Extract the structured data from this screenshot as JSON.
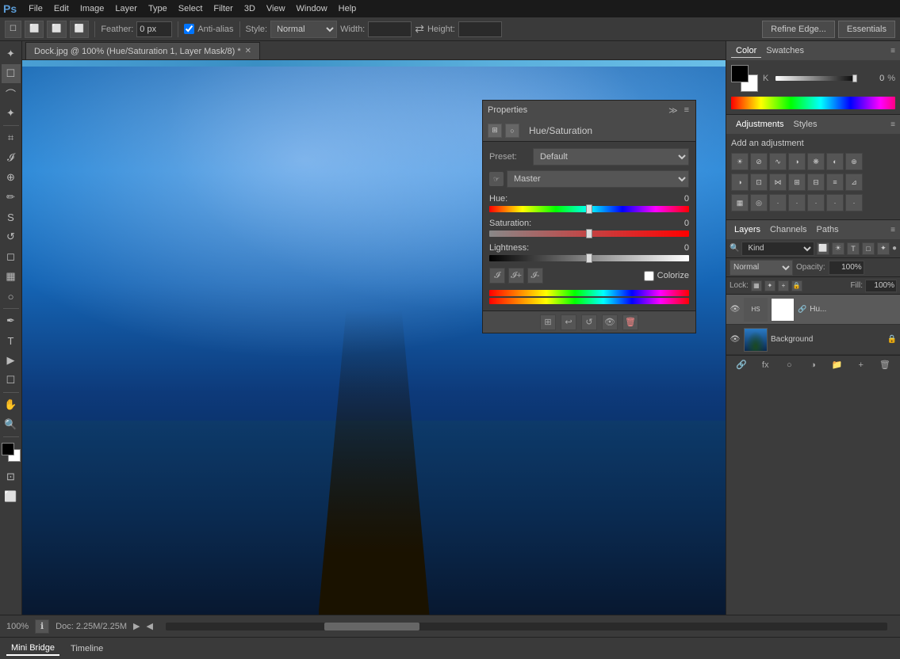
{
  "app": {
    "title": "Adobe Photoshop",
    "logo": "Ps",
    "workspace": "Essentials"
  },
  "menubar": {
    "items": [
      "PS",
      "File",
      "Edit",
      "Image",
      "Layer",
      "Type",
      "Select",
      "Filter",
      "3D",
      "View",
      "Window",
      "Help"
    ]
  },
  "toolbar": {
    "feather_label": "Feather:",
    "feather_value": "0 px",
    "anti_alias_label": "Anti-alias",
    "style_label": "Style:",
    "style_value": "Normal",
    "width_label": "Width:",
    "height_label": "Height:",
    "refine_edge_label": "Refine Edge...",
    "essentials_label": "Essentials"
  },
  "document": {
    "tab_title": "Dock.jpg @ 100% (Hue/Saturation 1, Layer Mask/8) *"
  },
  "properties_panel": {
    "title": "Properties",
    "adjustment_title": "Hue/Saturation",
    "preset_label": "Preset:",
    "preset_value": "Default",
    "channel_label": "Master",
    "hue_label": "Hue:",
    "hue_value": "0",
    "saturation_label": "Saturation:",
    "saturation_value": "0",
    "lightness_label": "Lightness:",
    "lightness_value": "0",
    "colorize_label": "Colorize"
  },
  "color_panel": {
    "tab_color": "Color",
    "tab_swatches": "Swatches",
    "k_label": "K",
    "k_value": "0",
    "k_percent": "%"
  },
  "adjustments_panel": {
    "tab_adjustments": "Adjustments",
    "tab_styles": "Styles",
    "title": "Add an adjustment"
  },
  "layers_panel": {
    "tab_layers": "Layers",
    "tab_channels": "Channels",
    "tab_paths": "Paths",
    "search_placeholder": "Kind",
    "blend_mode": "Normal",
    "opacity_label": "Opacity:",
    "opacity_value": "100%",
    "lock_label": "Lock:",
    "fill_label": "Fill:",
    "fill_value": "100%",
    "layers": [
      {
        "name": "Hu...",
        "type": "adjustment",
        "visible": true
      },
      {
        "name": "Background",
        "type": "image",
        "visible": true,
        "locked": true
      }
    ]
  },
  "status_bar": {
    "zoom": "100%",
    "doc_info": "Doc: 2.25M/2.25M"
  },
  "mini_bridge": {
    "tab_bridge": "Mini Bridge",
    "tab_timeline": "Timeline"
  }
}
